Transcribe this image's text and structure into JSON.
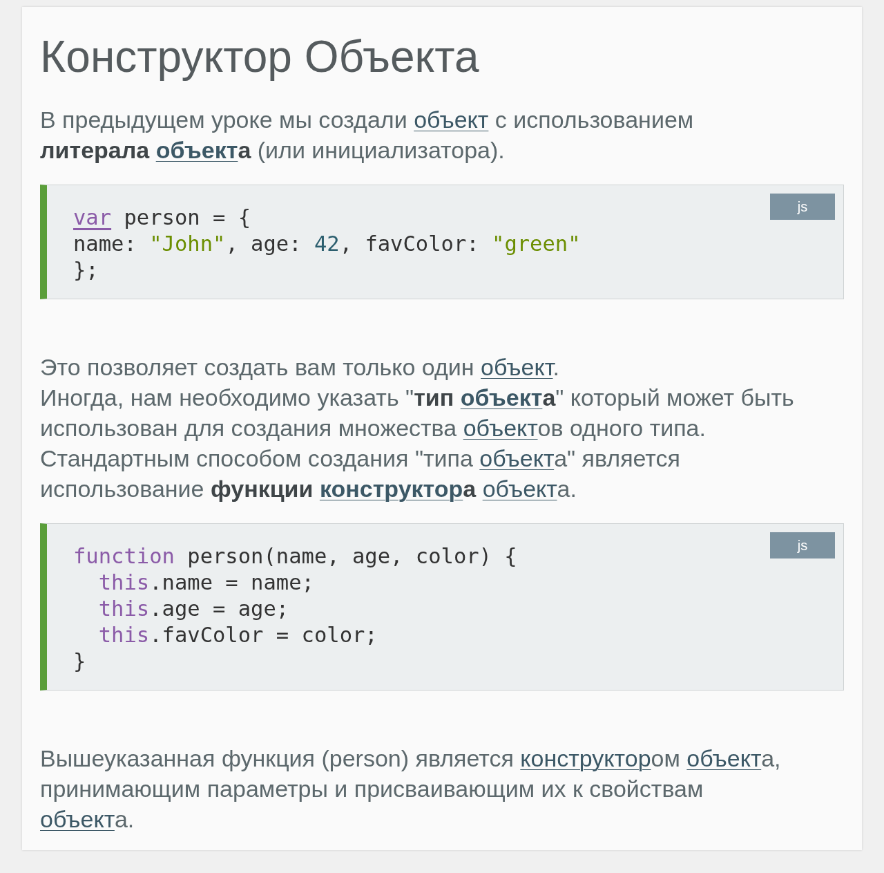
{
  "title": "Конструктор Объекта",
  "blocks": [
    {
      "kind": "text",
      "lines": [
        [
          {
            "text": "В предыдущем уроке мы создали ",
            "kind": "plain"
          },
          {
            "text": "объект",
            "kind": "link"
          },
          {
            "text": " с использованием",
            "kind": "plain"
          }
        ],
        [
          {
            "text": "литерала ",
            "kind": "bold"
          },
          {
            "text": "объект",
            "kind": "bold-link"
          },
          {
            "text": "а",
            "kind": "bold"
          },
          {
            "text": " (или инициализатора).",
            "kind": "plain"
          }
        ]
      ]
    },
    {
      "kind": "code",
      "badge": "js",
      "lines": [
        [
          {
            "text": "var",
            "kind": "keyword-link"
          },
          {
            "text": " person = {",
            "kind": "plain"
          }
        ],
        [
          {
            "text": "name: ",
            "kind": "plain"
          },
          {
            "text": "\"John\"",
            "kind": "string"
          },
          {
            "text": ", age: ",
            "kind": "plain"
          },
          {
            "text": "42",
            "kind": "number"
          },
          {
            "text": ", favColor: ",
            "kind": "plain"
          },
          {
            "text": "\"green\"",
            "kind": "string"
          }
        ],
        [
          {
            "text": "};",
            "kind": "plain"
          }
        ]
      ]
    },
    {
      "kind": "text",
      "lines": [
        [
          {
            "text": "Это позволяет создать вам только один ",
            "kind": "plain"
          },
          {
            "text": "объект",
            "kind": "link"
          },
          {
            "text": ".",
            "kind": "plain"
          }
        ],
        [
          {
            "text": "Иногда, нам необходимо указать \"",
            "kind": "plain"
          },
          {
            "text": "тип ",
            "kind": "bold"
          },
          {
            "text": "объект",
            "kind": "bold-link"
          },
          {
            "text": "а",
            "kind": "bold"
          },
          {
            "text": "\" который может быть",
            "kind": "plain"
          }
        ],
        [
          {
            "text": "использован для создания множества ",
            "kind": "plain"
          },
          {
            "text": "объект",
            "kind": "link"
          },
          {
            "text": "ов одного типа.",
            "kind": "plain"
          }
        ],
        [
          {
            "text": "Стандартным способом создания \"типа ",
            "kind": "plain"
          },
          {
            "text": "объект",
            "kind": "link"
          },
          {
            "text": "а\" является",
            "kind": "plain"
          }
        ],
        [
          {
            "text": "использование ",
            "kind": "plain"
          },
          {
            "text": "функции ",
            "kind": "bold"
          },
          {
            "text": "конструктор",
            "kind": "bold-link"
          },
          {
            "text": "а ",
            "kind": "bold"
          },
          {
            "text": "объект",
            "kind": "link"
          },
          {
            "text": "а.",
            "kind": "plain"
          }
        ]
      ]
    },
    {
      "kind": "code",
      "badge": "js",
      "lines": [
        [
          {
            "text": "function",
            "kind": "keyword"
          },
          {
            "text": " person(name, age, color) {",
            "kind": "plain"
          }
        ],
        [
          {
            "text": "  this",
            "kind": "keyword"
          },
          {
            "text": ".name = name;",
            "kind": "plain"
          }
        ],
        [
          {
            "text": "  this",
            "kind": "keyword"
          },
          {
            "text": ".age = age;",
            "kind": "plain"
          }
        ],
        [
          {
            "text": "  this",
            "kind": "keyword"
          },
          {
            "text": ".favColor = color;",
            "kind": "plain"
          }
        ],
        [
          {
            "text": "}",
            "kind": "plain"
          }
        ]
      ]
    },
    {
      "kind": "text",
      "lines": [
        [
          {
            "text": "Вышеуказанная функция (person) является ",
            "kind": "plain"
          },
          {
            "text": "конструктор",
            "kind": "link"
          },
          {
            "text": "ом ",
            "kind": "plain"
          },
          {
            "text": "объект",
            "kind": "link"
          },
          {
            "text": "а,",
            "kind": "plain"
          }
        ],
        [
          {
            "text": "принимающим параметры и присваивающим их к свойствам",
            "kind": "plain"
          }
        ],
        [
          {
            "text": "объект",
            "kind": "link"
          },
          {
            "text": "а.",
            "kind": "plain"
          }
        ]
      ]
    }
  ]
}
